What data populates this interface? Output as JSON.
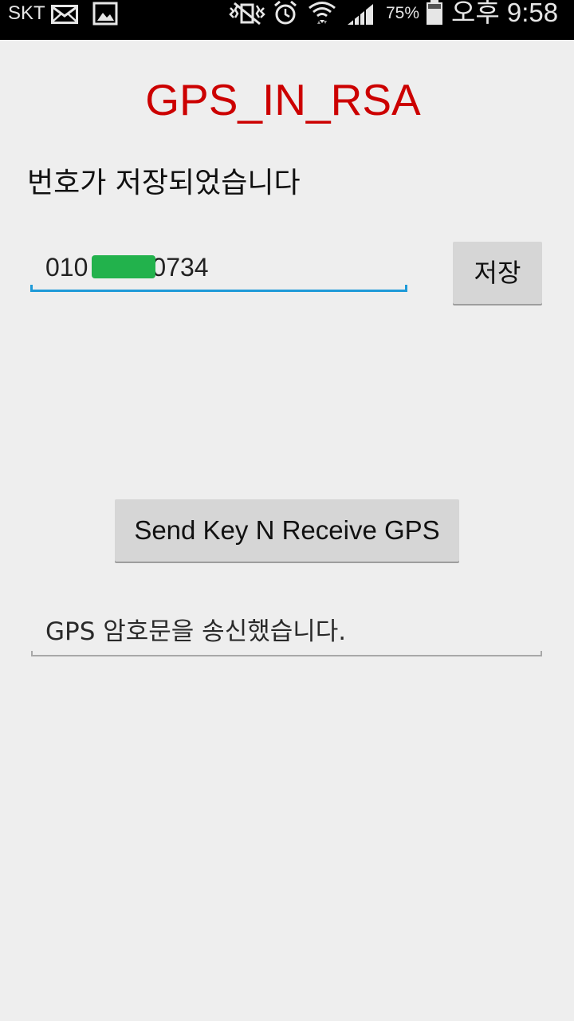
{
  "status_bar": {
    "carrier": "SKT",
    "battery_percent": "75%",
    "time": "오후 9:58",
    "icons": [
      "mail-icon",
      "gallery-icon",
      "vibrate-mute-icon",
      "alarm-icon",
      "wifi-icon",
      "signal-icon",
      "battery-icon"
    ]
  },
  "app": {
    "title": "GPS_IN_RSA",
    "title_color": "#cc0000",
    "status_message": "번호가 저장되었습니다",
    "phone_prefix": "010",
    "phone_suffix": "0734",
    "save_button_label": "저장",
    "send_button_label": "Send Key N Receive GPS",
    "result_text": "GPS 암호문을 송신했습니다."
  }
}
